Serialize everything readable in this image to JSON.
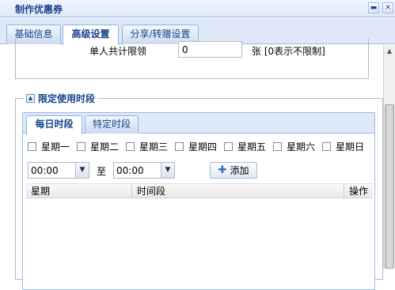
{
  "window": {
    "title": "制作优惠券"
  },
  "tabs": [
    {
      "label": "基础信息"
    },
    {
      "label": "高级设置"
    },
    {
      "label": "分享/转赠设置"
    }
  ],
  "limit": {
    "label": "单人共计限领",
    "value": "0",
    "unit": "张 [0表示不限制]"
  },
  "time_limit": {
    "legend": "限定使用时段",
    "tabs": [
      {
        "label": "每日时段"
      },
      {
        "label": "特定时段"
      }
    ],
    "days": [
      "星期一",
      "星期二",
      "星期三",
      "星期四",
      "星期五",
      "星期六",
      "星期日"
    ],
    "start_time": "00:00",
    "to_label": "至",
    "end_time": "00:00",
    "add_label": "添加",
    "grid_columns": [
      "星期",
      "时间段",
      "操作"
    ]
  },
  "icons": {
    "collapse": "collapse-icon",
    "close": "close-icon",
    "toggle": "fieldset-collapse-icon",
    "add": "plus-icon",
    "dropdown": "chevron-down-icon"
  }
}
